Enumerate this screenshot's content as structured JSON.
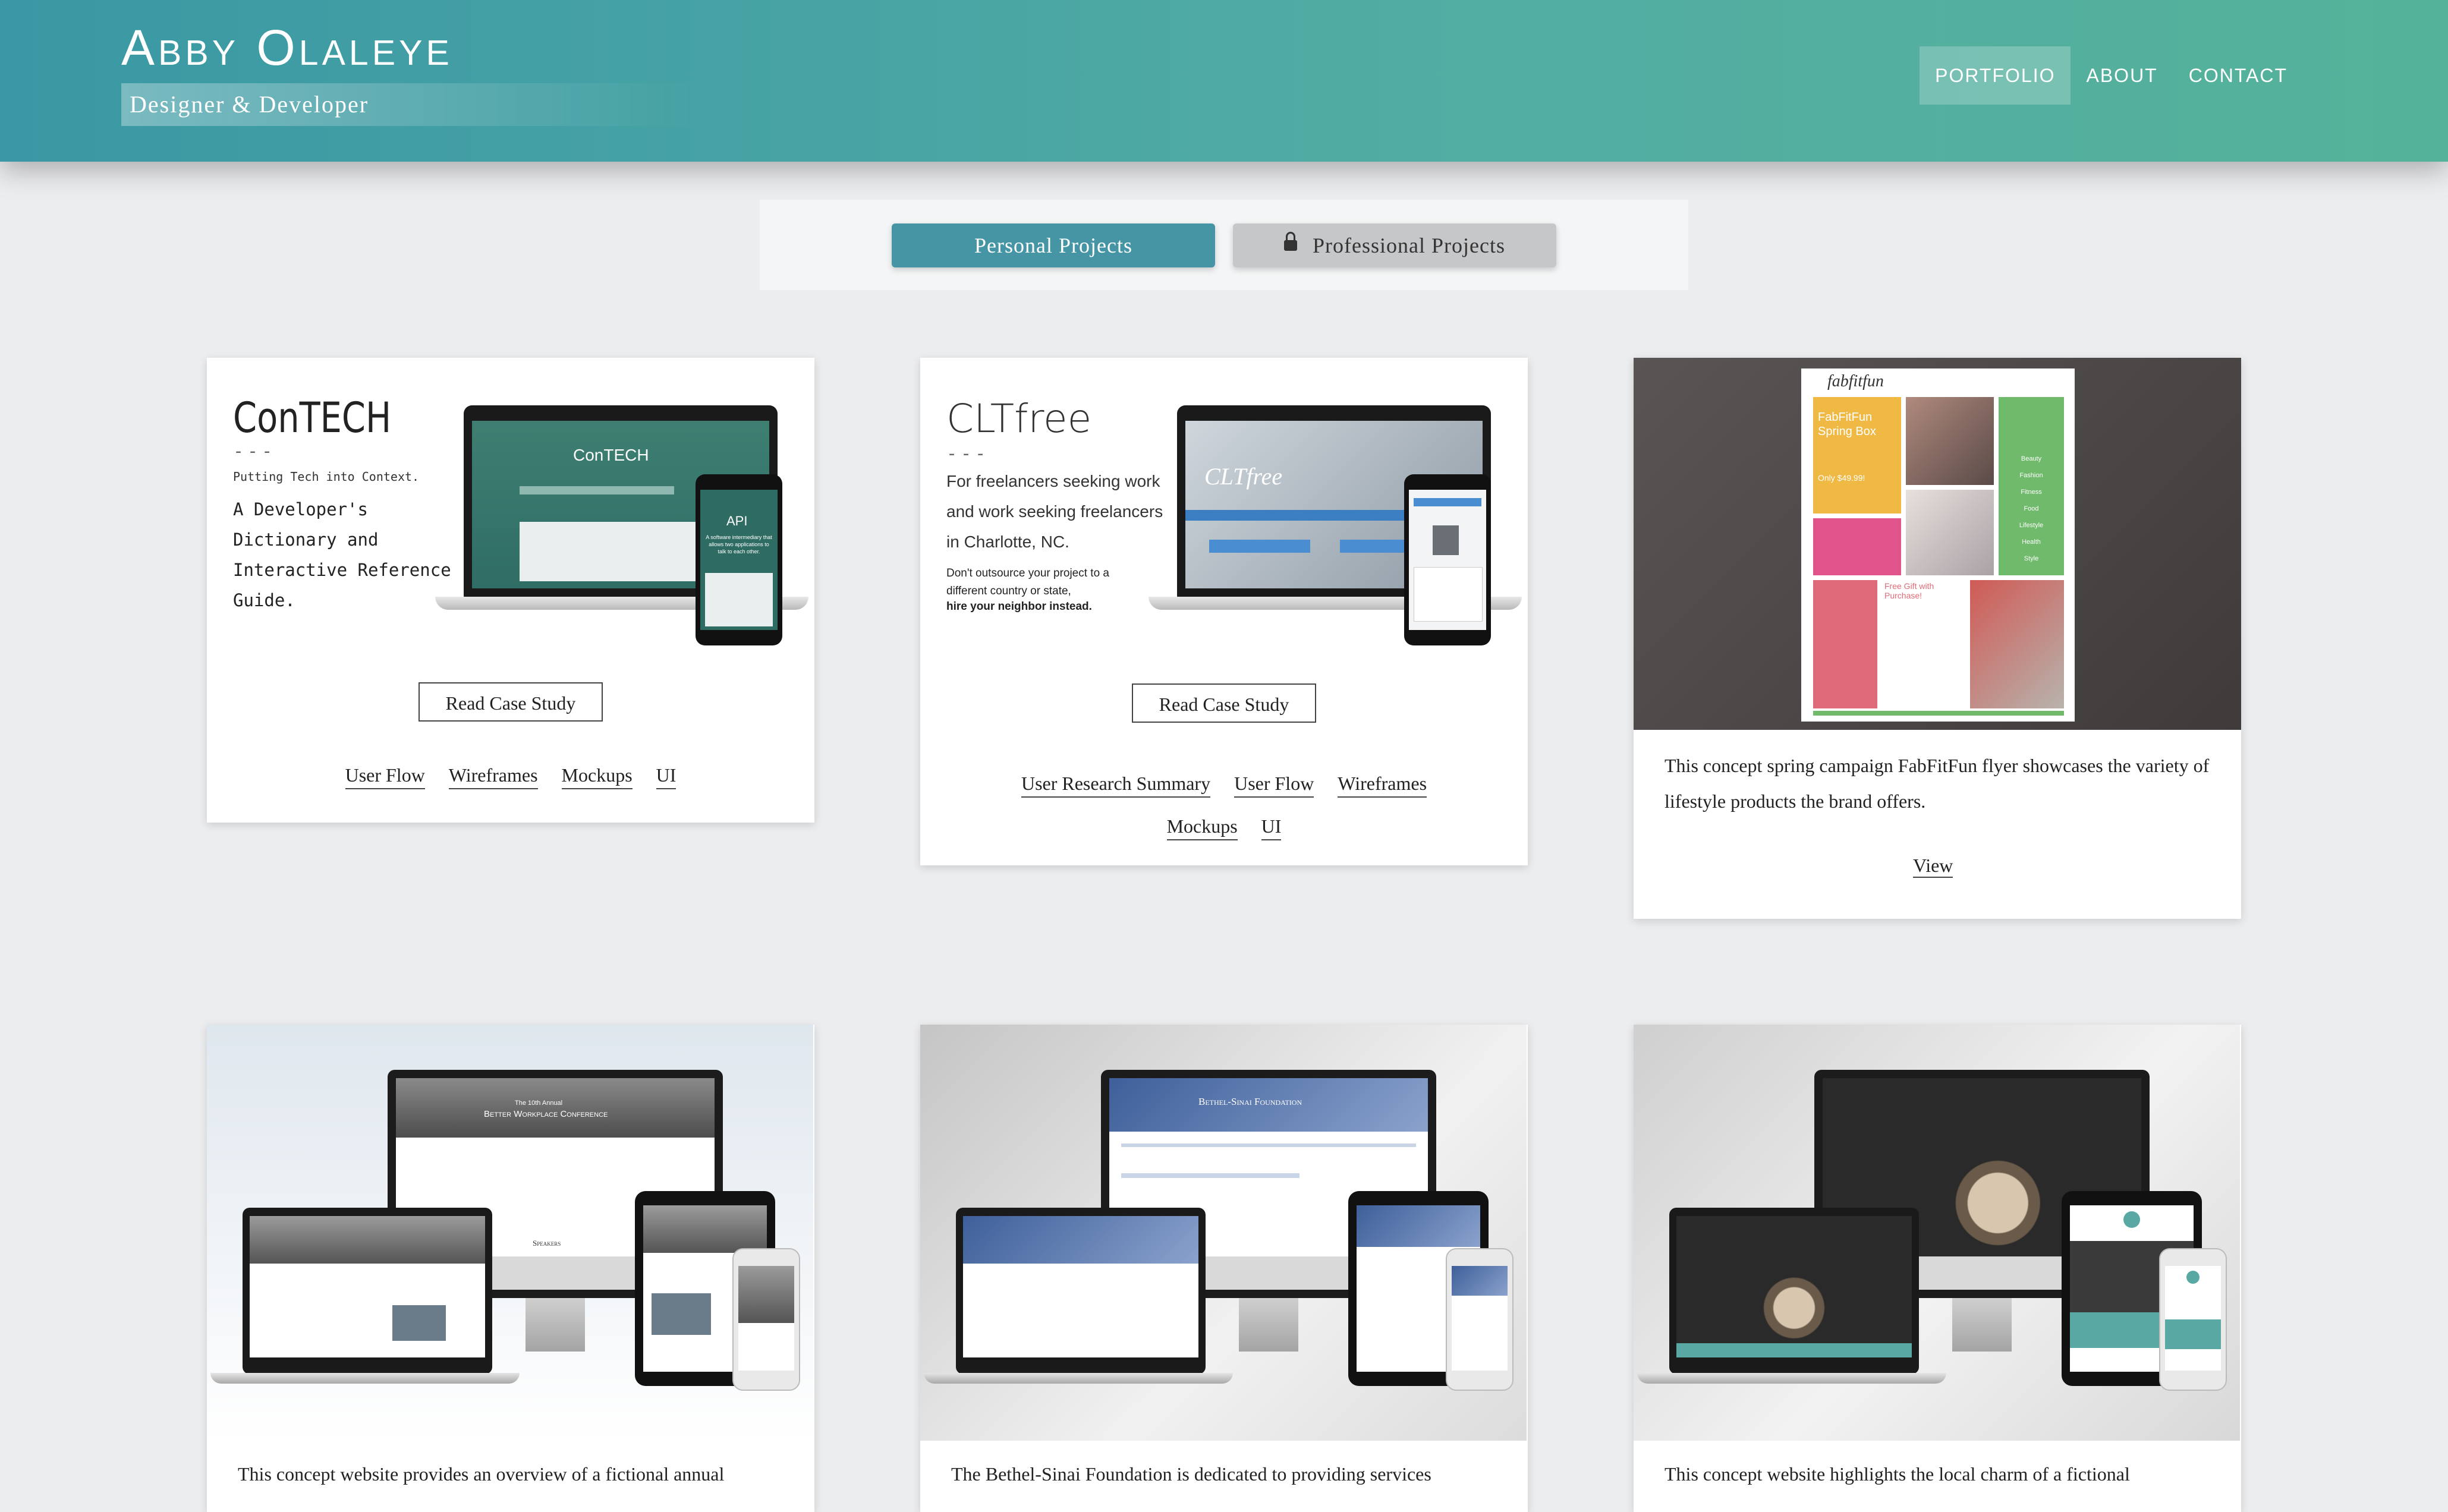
{
  "header": {
    "name": "Abby Olaleye",
    "tagline": "Designer & Developer",
    "nav": [
      {
        "label": "PORTFOLIO",
        "active": true
      },
      {
        "label": "ABOUT",
        "active": false
      },
      {
        "label": "CONTACT",
        "active": false
      }
    ]
  },
  "toggle": {
    "personal": "Personal Projects",
    "professional": "Professional Projects"
  },
  "cards": {
    "contech": {
      "title": "ConTECH",
      "dash": "---",
      "subtitle": "Putting Tech into Context.",
      "description": "A Developer's Dictionary and Interactive Reference Guide.",
      "screen_title": "ConTECH",
      "phone_text": "API",
      "phone_sub": "A software intermediary that allows two applications to talk to each other.",
      "button": "Read Case Study",
      "links": [
        "User Flow",
        "Wireframes",
        "Mockups",
        "UI"
      ]
    },
    "cltfree": {
      "title": "CLTfree",
      "dash": "---",
      "description": "For freelancers seeking work and work seeking freelancers in Charlotte, NC.",
      "note": "Don't outsource your project to a different country or state,",
      "note_bold": "hire your neighbor instead.",
      "screen_logo": "CLTfree",
      "button": "Read Case Study",
      "links": [
        "User Research Summary",
        "User Flow",
        "Wireframes",
        "Mockups",
        "UI"
      ]
    },
    "fabfitfun": {
      "logo": "fabfitfun",
      "flyer_title": "FabFitFun Spring Box",
      "flyer_price": "Only $49.99!",
      "flyer_offer": "Free Gift with Purchase!",
      "flyer_categories": [
        "Beauty",
        "Fashion",
        "Fitness",
        "Food",
        "Lifestyle",
        "Health",
        "Style"
      ],
      "description": "This concept spring campaign FabFitFun flyer showcases the variety of lifestyle products the brand offers.",
      "view": "View"
    },
    "workplace": {
      "screen_title": "Better Workplace Conference",
      "screen_kicker": "The 10th Annual",
      "screen_section": "Speakers",
      "description": "This concept website provides an overview of a fictional annual"
    },
    "bethel": {
      "screen_title": "Bethel-Sinai Foundation",
      "description": "The Bethel-Sinai Foundation is dedicated to providing services"
    },
    "cafe": {
      "description": "This concept website highlights the local charm of a fictional"
    }
  }
}
